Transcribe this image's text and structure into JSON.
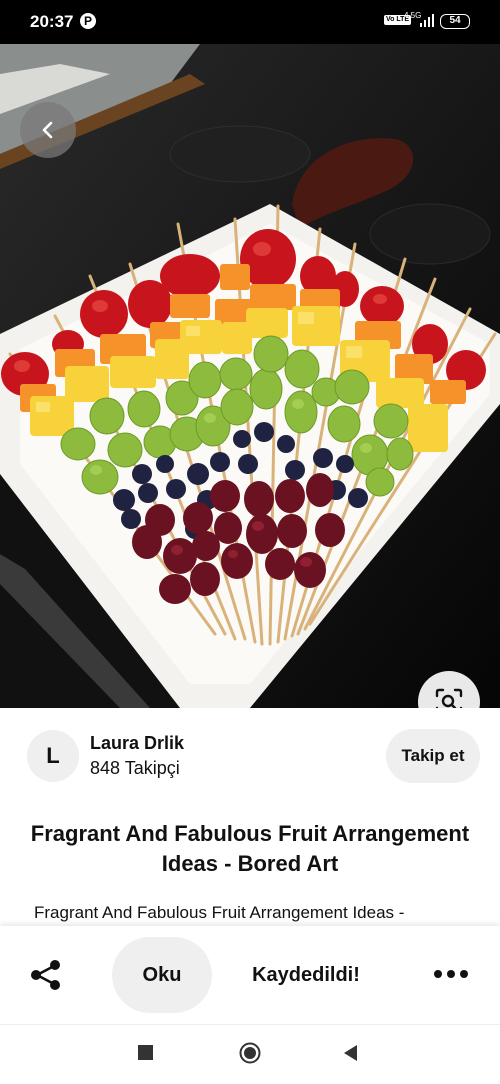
{
  "status_bar": {
    "time": "20:37",
    "app_icon": "P",
    "volte": "Vo LTE",
    "network": "4.5G",
    "battery": "54"
  },
  "hero": {
    "icon_back": "chevron-left-icon",
    "icon_lens": "visual-search-icon"
  },
  "author": {
    "initial": "L",
    "name": "Laura Drlik",
    "followers": "848 Takipçi",
    "follow_label": "Takip et"
  },
  "pin": {
    "title": "Fragrant And Fabulous Fruit Arrangement Ideas - Bored Art",
    "description": "Fragrant And Fabulous Fruit Arrangement Ideas -"
  },
  "actions": {
    "read_label": "Oku",
    "saved_label": "Kaydedildi!",
    "icon_share": "share-icon",
    "icon_more": "more-icon"
  },
  "colors": {
    "strawberry": "#c8151d",
    "orange": "#f5932a",
    "pineapple": "#f8d23a",
    "green_grape": "#8dbb3d",
    "blueberry": "#1f2240",
    "red_grape": "#6a1122",
    "plate": "#f4f2ee",
    "pill": "#efefef"
  }
}
